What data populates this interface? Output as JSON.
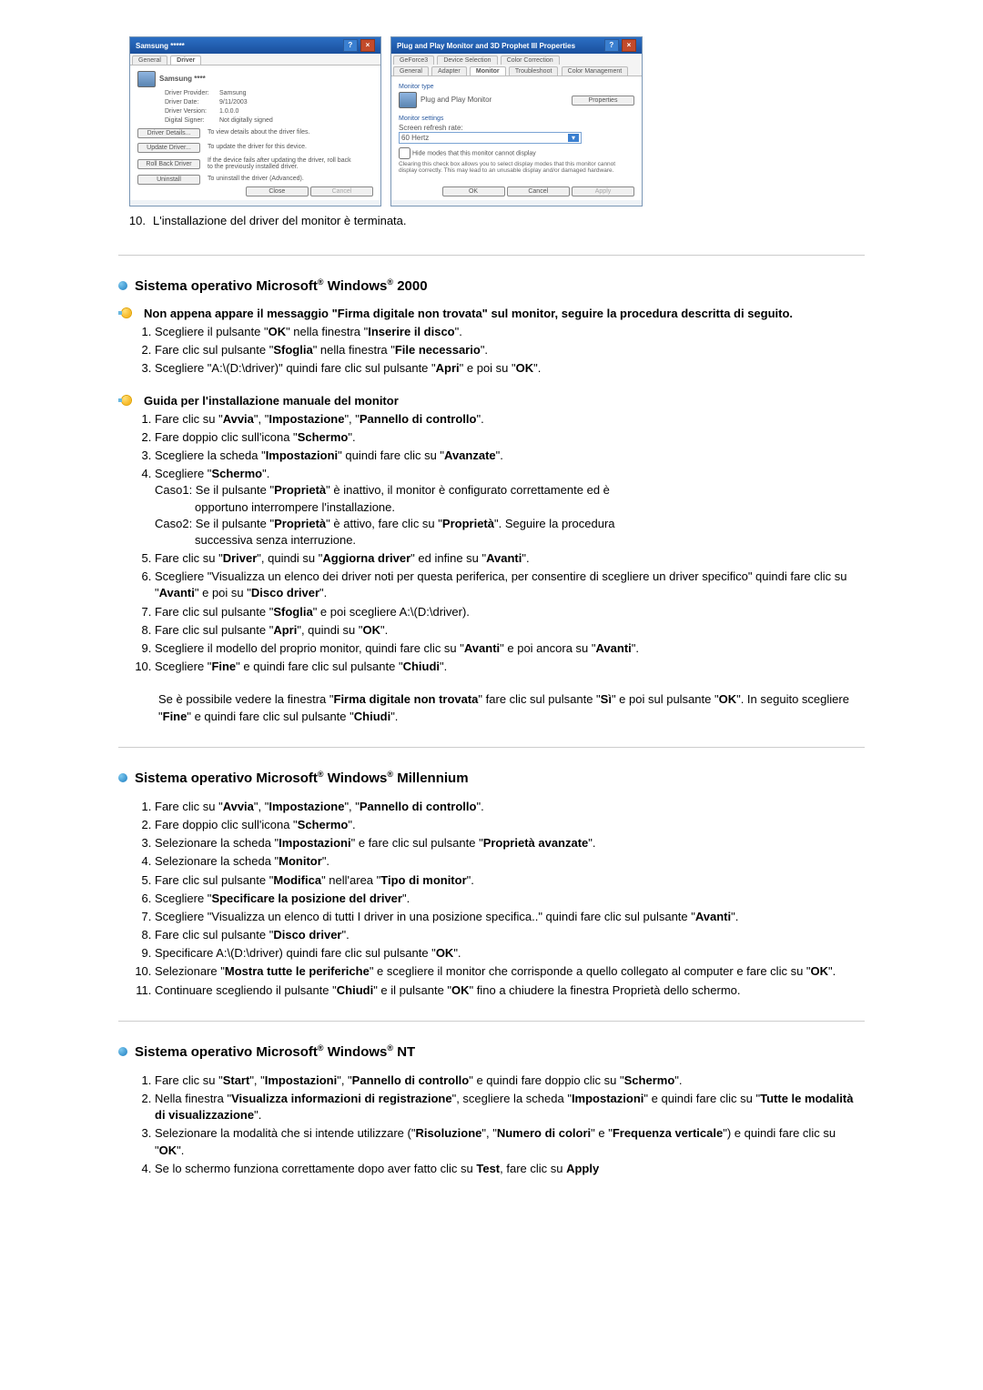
{
  "screenshot1": {
    "title": "Samsung *****",
    "tabs": {
      "general": "General",
      "driver": "Driver"
    },
    "device_label": "Samsung ****",
    "rows": {
      "provider_lbl": "Driver Provider:",
      "provider_val": "Samsung",
      "date_lbl": "Driver Date:",
      "date_val": "9/11/2003",
      "version_lbl": "Driver Version:",
      "version_val": "1.0.0.0",
      "signer_lbl": "Digital Signer:",
      "signer_val": "Not digitally signed"
    },
    "buttons": {
      "details": "Driver Details...",
      "details_desc": "To view details about the driver files.",
      "update": "Update Driver...",
      "update_desc": "To update the driver for this device.",
      "rollback": "Roll Back Driver",
      "rollback_desc": "If the device fails after updating the driver, roll back to the previously installed driver.",
      "uninstall": "Uninstall",
      "uninstall_desc": "To uninstall the driver (Advanced)."
    },
    "footer": {
      "close": "Close",
      "cancel": "Cancel"
    }
  },
  "screenshot2": {
    "title": "Plug and Play Monitor and 3D Prophet III Properties",
    "tabs_top": {
      "geforce": "GeForce3",
      "device_sel": "Device Selection",
      "color_corr": "Color Correction"
    },
    "tabs_bot": {
      "general": "General",
      "adapter": "Adapter",
      "monitor": "Monitor",
      "troubleshoot": "Troubleshoot",
      "color_mgmt": "Color Management"
    },
    "monitor_type_lbl": "Monitor type",
    "monitor_name": "Plug and Play Monitor",
    "properties_btn": "Properties",
    "monitor_settings_lbl": "Monitor settings",
    "refresh_lbl": "Screen refresh rate:",
    "refresh_val": "60 Hertz",
    "hide_modes": "Hide modes that this monitor cannot display",
    "hide_modes_note": "Clearing this check box allows you to select display modes that this monitor cannot display correctly. This may lead to an unusable display and/or damaged hardware.",
    "footer": {
      "ok": "OK",
      "cancel": "Cancel",
      "apply": "Apply"
    }
  },
  "final_step": {
    "num": "10.",
    "text": "L'installazione del driver del monitor è terminata."
  },
  "win2000": {
    "heading_pre": "Sistema operativo Microsoft",
    "heading_mid": " Windows",
    "heading_post": " 2000",
    "intro": "Non appena appare il messaggio \"Firma digitale non trovata\" sul monitor, seguire la procedura descritta di seguito.",
    "step1_a": "Scegliere il pulsante \"",
    "step1_ok": "OK",
    "step1_b": "\" nella finestra \"",
    "step1_ins": "Inserire il disco",
    "step1_c": "\".",
    "step2_a": "Fare clic sul pulsante \"",
    "step2_sf": "Sfoglia",
    "step2_b": "\" nella finestra \"",
    "step2_fn": "File necessario",
    "step2_c": "\".",
    "step3_a": "Scegliere \"A:\\(D:\\driver)\" quindi fare clic sul pulsante \"",
    "step3_apri": "Apri",
    "step3_b": "\" e poi su \"",
    "step3_ok": "OK",
    "step3_c": "\".",
    "guide_heading": "Guida per l'installazione manuale del monitor",
    "g1_a": "Fare clic su \"",
    "g1_avvia": "Avvia",
    "g1_b": "\", \"",
    "g1_imp": "Impostazione",
    "g1_c": "\", \"",
    "g1_pan": "Pannello di controllo",
    "g1_d": "\".",
    "g2_a": "Fare doppio clic sull'icona \"",
    "g2_sch": "Schermo",
    "g2_b": "\".",
    "g3_a": "Scegliere la scheda \"",
    "g3_imp": "Impostazioni",
    "g3_b": "\" quindi fare clic su \"",
    "g3_avz": "Avanzate",
    "g3_c": "\".",
    "g4_a": "Scegliere \"",
    "g4_sch": "Schermo",
    "g4_b": "\".",
    "caso1_a": "Caso1: Se il pulsante \"",
    "caso1_prop": "Proprietà",
    "caso1_b": "\" è inattivo, il monitor è configurato correttamente ed è",
    "caso1_c": "opportuno interrompere l'installazione.",
    "caso2_a": "Caso2: Se il pulsante \"",
    "caso2_prop": "Proprietà",
    "caso2_b": "\" è attivo, fare clic su \"",
    "caso2_prop2": "Proprietà",
    "caso2_c": "\". Seguire la procedura",
    "caso2_d": "successiva senza interruzione.",
    "g5_a": "Fare clic su \"",
    "g5_drv": "Driver",
    "g5_b": "\", quindi su \"",
    "g5_agg": "Aggiorna driver",
    "g5_c": "\" ed infine su \"",
    "g5_av": "Avanti",
    "g5_d": "\".",
    "g6_a": "Scegliere \"Visualizza un elenco dei driver noti per questa periferica, per consentire di scegliere un driver specifico\" quindi fare clic su \"",
    "g6_av": "Avanti",
    "g6_b": "\" e poi su \"",
    "g6_dd": "Disco driver",
    "g6_c": "\".",
    "g7_a": "Fare clic sul pulsante \"",
    "g7_sf": "Sfoglia",
    "g7_b": "\" e poi scegliere A:\\(D:\\driver).",
    "g8_a": "Fare clic sul pulsante \"",
    "g8_apri": "Apri",
    "g8_b": "\", quindi su \"",
    "g8_ok": "OK",
    "g8_c": "\".",
    "g9_a": "Scegliere il modello del proprio monitor, quindi fare clic su \"",
    "g9_av": "Avanti",
    "g9_b": "\" e poi ancora su \"",
    "g9_av2": "Avanti",
    "g9_c": "\".",
    "g10_a": "Scegliere \"",
    "g10_fine": "Fine",
    "g10_b": "\" e quindi fare clic sul pulsante \"",
    "g10_ch": "Chiudi",
    "g10_c": "\".",
    "note_a": "Se è possibile vedere la finestra \"",
    "note_fdnt": "Firma digitale non trovata",
    "note_b": "\" fare clic sul pulsante \"",
    "note_si": "Sì",
    "note_c": "\" e poi sul pulsante \"",
    "note_ok": "OK",
    "note_d": "\". In seguito scegliere \"",
    "note_fine": "Fine",
    "note_e": "\" e quindi fare clic sul pulsante \"",
    "note_ch": "Chiudi",
    "note_f": "\"."
  },
  "winme": {
    "heading_pre": "Sistema operativo Microsoft",
    "heading_mid": " Windows",
    "heading_post": " Millennium",
    "s1_a": "Fare clic su \"",
    "s1_avvia": "Avvia",
    "s1_b": "\", \"",
    "s1_imp": "Impostazione",
    "s1_c": "\", \"",
    "s1_pan": "Pannello di controllo",
    "s1_d": "\".",
    "s2_a": "Fare doppio clic sull'icona \"",
    "s2_sch": "Schermo",
    "s2_b": "\".",
    "s3_a": "Selezionare la scheda \"",
    "s3_imp": "Impostazioni",
    "s3_b": "\" e fare clic sul pulsante \"",
    "s3_pav": "Proprietà avanzate",
    "s3_c": "\".",
    "s4_a": "Selezionare la scheda \"",
    "s4_mon": "Monitor",
    "s4_b": "\".",
    "s5_a": "Fare clic sul pulsante \"",
    "s5_mod": "Modifica",
    "s5_b": "\" nell'area \"",
    "s5_tipo": "Tipo di monitor",
    "s5_c": "\".",
    "s6_a": "Scegliere \"",
    "s6_spec": "Specificare la posizione del driver",
    "s6_b": "\".",
    "s7_a": "Scegliere \"Visualizza un elenco di tutti I driver in una posizione specifica..\" quindi fare clic sul pulsante \"",
    "s7_av": "Avanti",
    "s7_b": "\".",
    "s8_a": "Fare clic sul pulsante \"",
    "s8_dd": "Disco driver",
    "s8_b": "\".",
    "s9_a": "Specificare A:\\(D:\\driver) quindi fare clic sul pulsante \"",
    "s9_ok": "OK",
    "s9_b": "\".",
    "s10_a": "Selezionare \"",
    "s10_mtlp": "Mostra tutte le periferiche",
    "s10_b": "\" e scegliere il monitor che corrisponde a quello collegato al computer e fare clic su \"",
    "s10_ok": "OK",
    "s10_c": "\".",
    "s11_a": "Continuare scegliendo il pulsante \"",
    "s11_ch": "Chiudi",
    "s11_b": "\" e il pulsante \"",
    "s11_ok": "OK",
    "s11_c": "\" fino a chiudere la finestra Proprietà dello schermo."
  },
  "winnt": {
    "heading_pre": "Sistema operativo Microsoft",
    "heading_mid": " Windows",
    "heading_post": " NT",
    "s1_a": "Fare clic su \"",
    "s1_start": "Start",
    "s1_b": "\", \"",
    "s1_imp": "Impostazioni",
    "s1_c": "\", \"",
    "s1_pan": "Pannello di controllo",
    "s1_d": "\" e quindi fare doppio clic su \"",
    "s1_sch": "Schermo",
    "s1_e": "\".",
    "s2_a": "Nella finestra \"",
    "s2_vir": "Visualizza informazioni di registrazione",
    "s2_b": "\", scegliere la scheda \"",
    "s2_imp": "Impostazioni",
    "s2_c": "\" e quindi fare clic su \"",
    "s2_tmdv": "Tutte le modalità di visualizzazione",
    "s2_d": "\".",
    "s3_a": "Selezionare la modalità che si intende utilizzare (\"",
    "s3_ris": "Risoluzione",
    "s3_b": "\", \"",
    "s3_nc": "Numero di colori",
    "s3_c": "\" e \"",
    "s3_fv": "Frequenza verticale",
    "s3_d": "\") e quindi fare clic su \"",
    "s3_ok": "OK",
    "s3_e": "\".",
    "s4_a": "Se lo schermo funziona correttamente dopo aver fatto clic su ",
    "s4_test": "Test",
    "s4_b": ", fare clic su ",
    "s4_apply": "Apply"
  }
}
